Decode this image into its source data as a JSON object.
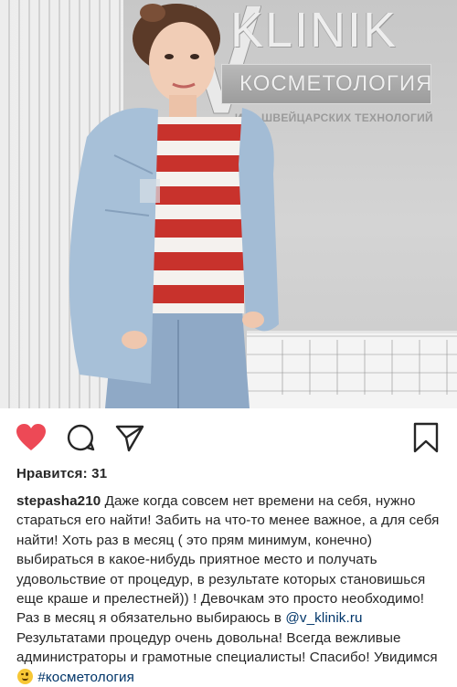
{
  "post": {
    "photo_alt": "",
    "wall_logo": {
      "brand": "KLINIK",
      "subtitle": "КОСМЕТОЛОГИЯ",
      "tagline": "...ИКА ШВЕЙЦАРСКИХ ТЕХНОЛОГИЙ"
    },
    "actions": {
      "like_icon": "heart-icon",
      "comment_icon": "comment-icon",
      "share_icon": "send-icon",
      "save_icon": "bookmark-icon",
      "liked_color": "#ed4956"
    },
    "likes_text": "Нравится: 31",
    "caption": {
      "username": "stepasha210",
      "text_part1": "Даже когда совсем нет времени на себя, нужно стараться его найти! Забить на что-то менее важное, а для себя найти! Хоть раз в месяц ( это прям минимум, конечно) выбираться в какое-нибудь приятное место и получать удовольствие от процедур, в результате которых становишься еще краше и прелестней)) ! Девочкам это просто необходимо! Раз в месяц я обязательно выбираюсь в",
      "mention": "@v_klinik.ru",
      "text_part2": "Результатами процедур очень довольна! Всегда вежливые администраторы и грамотные специалисты! Спасибо! Увидимся",
      "emoji": "winking-face-emoji",
      "hashtag": "#косметология",
      "link_color": "#003569"
    }
  }
}
